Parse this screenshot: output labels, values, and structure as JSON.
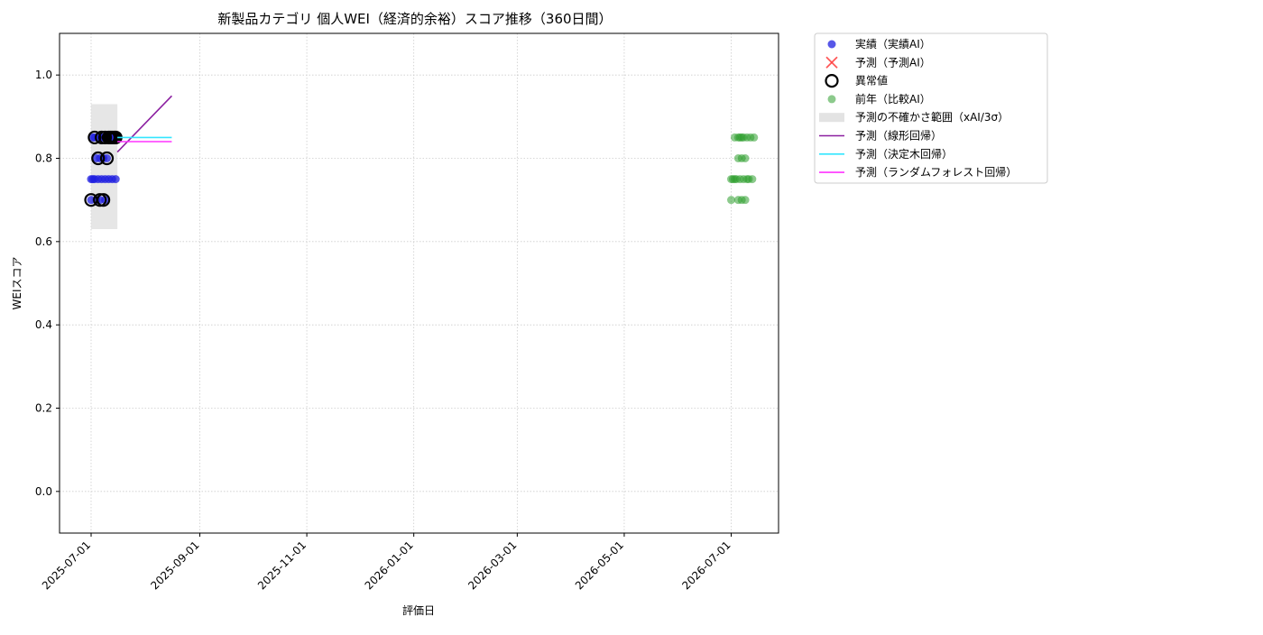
{
  "chart_data": {
    "type": "scatter",
    "title": "新製品カテゴリ 個人WEI（経済的余裕）スコア推移（360日間）",
    "xlabel": "評価日",
    "ylabel": "WEIスコア",
    "x_range": [
      "2025-06-13",
      "2026-07-28"
    ],
    "ylim": [
      -0.1,
      1.1
    ],
    "x_ticks": [
      "2025-07-01",
      "2025-09-01",
      "2025-11-01",
      "2026-01-01",
      "2026-03-01",
      "2026-05-01",
      "2026-07-01"
    ],
    "y_ticks": [
      "0.0",
      "0.2",
      "0.4",
      "0.6",
      "0.8",
      "1.0"
    ],
    "grid": true,
    "legend_position": "outside-right-top",
    "colors": {
      "actual": "#1f1fe0",
      "forecast": "#ff3b3b",
      "anomaly": "#000000",
      "prev_year": "#2e9e2e",
      "uncertainty": "#dcdcdc",
      "linear": "#8b1fa0",
      "tree": "#33e6ff",
      "forest": "#ff33ff"
    },
    "legend": [
      {
        "key": "actual",
        "label": "実績（実績AI）"
      },
      {
        "key": "forecast",
        "label": "予測（予測AI）"
      },
      {
        "key": "anomaly",
        "label": "異常値"
      },
      {
        "key": "prev_year",
        "label": "前年（比較AI）"
      },
      {
        "key": "uncertainty",
        "label": "予測の不確かさ範囲（xAI/3σ）"
      },
      {
        "key": "linear",
        "label": "予測（線形回帰）"
      },
      {
        "key": "tree",
        "label": "予測（決定木回帰）"
      },
      {
        "key": "forest",
        "label": "予測（ランダムフォレスト回帰）"
      }
    ],
    "series": [
      {
        "key": "actual",
        "points": [
          [
            "2025-07-01",
            0.7
          ],
          [
            "2025-07-01",
            0.75
          ],
          [
            "2025-07-02",
            0.85
          ],
          [
            "2025-07-02",
            0.75
          ],
          [
            "2025-07-03",
            0.85
          ],
          [
            "2025-07-03",
            0.75
          ],
          [
            "2025-07-04",
            0.8
          ],
          [
            "2025-07-04",
            0.7
          ],
          [
            "2025-07-05",
            0.85
          ],
          [
            "2025-07-05",
            0.75
          ],
          [
            "2025-07-06",
            0.8
          ],
          [
            "2025-07-06",
            0.7
          ],
          [
            "2025-07-07",
            0.85
          ],
          [
            "2025-07-07",
            0.75
          ],
          [
            "2025-07-08",
            0.8
          ],
          [
            "2025-07-08",
            0.85
          ],
          [
            "2025-07-09",
            0.75
          ],
          [
            "2025-07-09",
            0.7
          ],
          [
            "2025-07-10",
            0.85
          ],
          [
            "2025-07-10",
            0.8
          ],
          [
            "2025-07-11",
            0.75
          ],
          [
            "2025-07-12",
            0.85
          ],
          [
            "2025-07-13",
            0.75
          ],
          [
            "2025-07-14",
            0.85
          ],
          [
            "2025-07-15",
            0.75
          ]
        ]
      },
      {
        "key": "anomaly",
        "points": [
          [
            "2025-07-01",
            0.7
          ],
          [
            "2025-07-03",
            0.85
          ],
          [
            "2025-07-05",
            0.8
          ],
          [
            "2025-07-06",
            0.7
          ],
          [
            "2025-07-07",
            0.85
          ],
          [
            "2025-07-08",
            0.7
          ],
          [
            "2025-07-09",
            0.85
          ],
          [
            "2025-07-10",
            0.8
          ],
          [
            "2025-07-11",
            0.85
          ],
          [
            "2025-07-12",
            0.85
          ],
          [
            "2025-07-13",
            0.85
          ],
          [
            "2025-07-14",
            0.85
          ],
          [
            "2025-07-15",
            0.85
          ]
        ]
      },
      {
        "key": "prev_year",
        "points": [
          [
            "2026-07-01",
            0.7
          ],
          [
            "2026-07-01",
            0.75
          ],
          [
            "2026-07-02",
            0.75
          ],
          [
            "2026-07-03",
            0.85
          ],
          [
            "2026-07-03",
            0.75
          ],
          [
            "2026-07-04",
            0.75
          ],
          [
            "2026-07-05",
            0.7
          ],
          [
            "2026-07-05",
            0.8
          ],
          [
            "2026-07-05",
            0.85
          ],
          [
            "2026-07-06",
            0.75
          ],
          [
            "2026-07-06",
            0.85
          ],
          [
            "2026-07-07",
            0.8
          ],
          [
            "2026-07-07",
            0.7
          ],
          [
            "2026-07-07",
            0.85
          ],
          [
            "2026-07-08",
            0.75
          ],
          [
            "2026-07-08",
            0.85
          ],
          [
            "2026-07-09",
            0.8
          ],
          [
            "2026-07-09",
            0.7
          ],
          [
            "2026-07-10",
            0.85
          ],
          [
            "2026-07-10",
            0.75
          ],
          [
            "2026-07-11",
            0.75
          ],
          [
            "2026-07-12",
            0.85
          ],
          [
            "2026-07-13",
            0.75
          ],
          [
            "2026-07-14",
            0.85
          ]
        ]
      }
    ],
    "uncertainty_band": {
      "x_start": "2025-07-01",
      "x_end": "2025-07-16",
      "y_low": 0.63,
      "y_high": 0.93
    },
    "lines": [
      {
        "key": "linear",
        "points": [
          [
            "2025-07-16",
            0.815
          ],
          [
            "2025-08-16",
            0.95
          ]
        ]
      },
      {
        "key": "tree",
        "points": [
          [
            "2025-07-16",
            0.85
          ],
          [
            "2025-08-16",
            0.85
          ]
        ]
      },
      {
        "key": "forest",
        "points": [
          [
            "2025-07-16",
            0.84
          ],
          [
            "2025-08-16",
            0.84
          ]
        ]
      }
    ]
  }
}
